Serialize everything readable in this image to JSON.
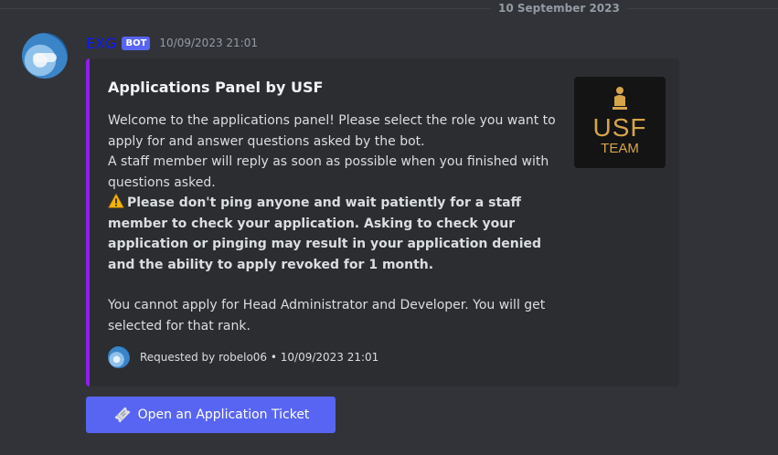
{
  "divider": {
    "date": "10 September 2023"
  },
  "message": {
    "author": "EXG",
    "bot_tag": "BOT",
    "timestamp": "10/09/2023 21:01"
  },
  "embed": {
    "accent_color": "#8f1ef0",
    "title": "Applications Panel by USF",
    "description_line1": "Welcome to the applications panel! Please select the role you want to apply for and answer questions asked by the bot.",
    "description_line2": "A staff member will reply as soon as possible when you finished with questions asked.",
    "warning_icon": "warning-icon",
    "warning_text": "Please don't ping anyone and wait patiently for a staff member to check your application. Asking to check your application or pinging may result in your application denied and the ability to apply revoked for 1 month.",
    "note": "You cannot apply for Head Administrator and Developer. You will get selected for that rank.",
    "thumbnail": {
      "logo_text": "USF",
      "logo_subtext": "TEAM",
      "color": "#d6a54a"
    },
    "footer": "Requested by robelo06 • 10/09/2023 21:01"
  },
  "button": {
    "label": "Open an Application Ticket",
    "icon": "ticket-icon",
    "color": "#5865f2"
  }
}
